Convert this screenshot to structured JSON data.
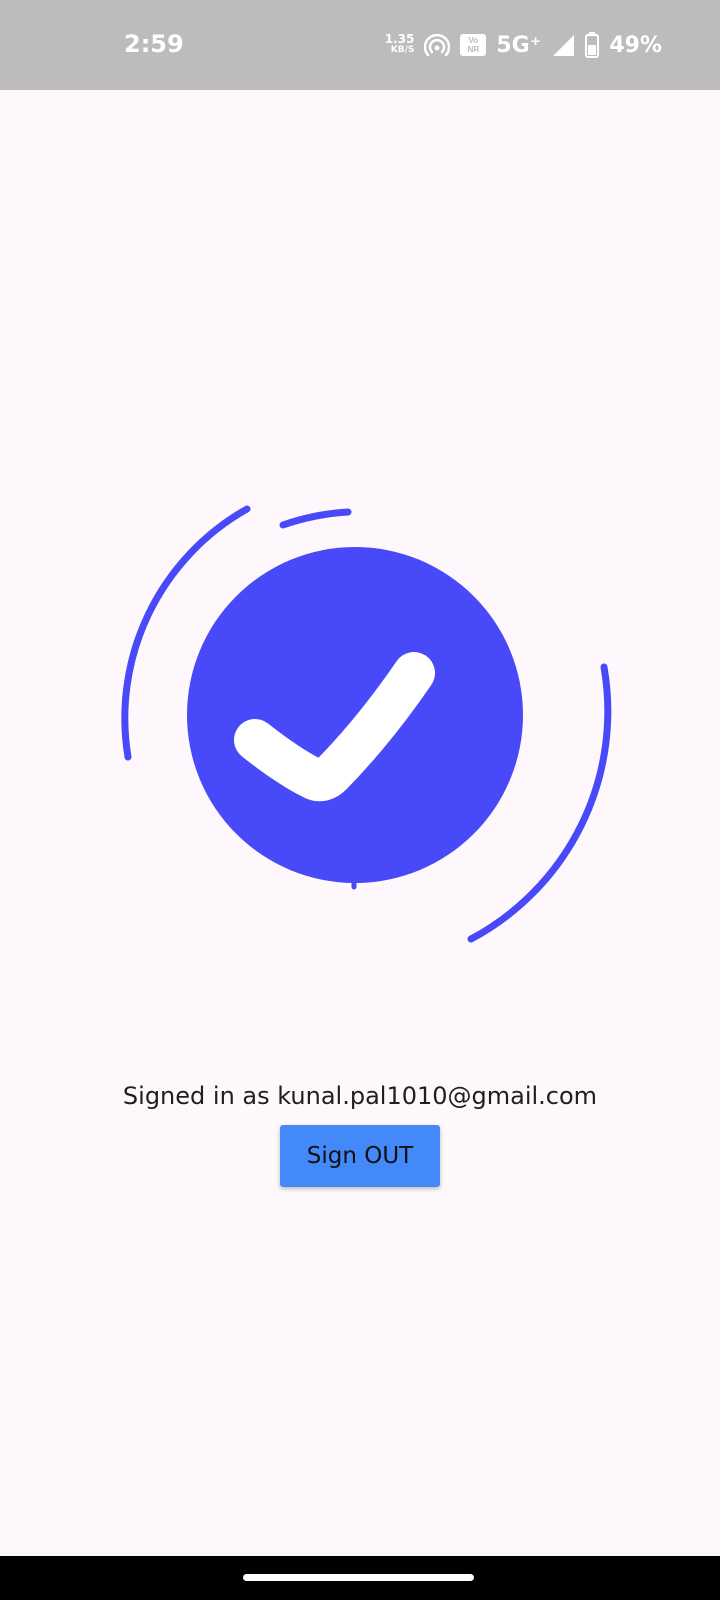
{
  "status_bar": {
    "time": "2:59",
    "net_speed_value": "1.35",
    "net_speed_unit": "KB/S",
    "volte_top": "Vo",
    "volte_bottom": "NR",
    "network_type": "5G⁺",
    "battery": "49%"
  },
  "main": {
    "signed_in_text": "Signed in as kunal.pal1010@gmail.com",
    "sign_out_label": "Sign OUT"
  },
  "colors": {
    "accent": "#4849f8",
    "button": "#4389f9",
    "background": "#fef8fc",
    "status_bar": "#bdbbbc"
  },
  "icons": [
    "hotspot-icon",
    "signal-icon",
    "battery-icon",
    "checkmark-icon"
  ]
}
